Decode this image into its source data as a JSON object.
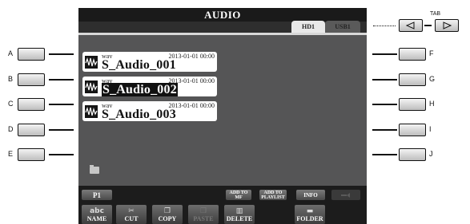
{
  "screen": {
    "title": "AUDIO",
    "tabs": [
      {
        "label": "HD1",
        "active": true
      },
      {
        "label": "USB1",
        "active": false
      }
    ],
    "files": [
      {
        "type": "wav",
        "date": "2013-01-01 00:00",
        "name": "S_Audio_001",
        "selected": false
      },
      {
        "type": "wav",
        "date": "2013-01-01 00:00",
        "name": "S_Audio_002",
        "selected": true
      },
      {
        "type": "wav",
        "date": "2013-01-01 00:00",
        "name": "S_Audio_003",
        "selected": false
      }
    ],
    "page_label": "P1",
    "side_buttons": {
      "add_to_mf": [
        "ADD TO",
        "MF"
      ],
      "add_to_playlist": [
        "ADD TO",
        "PLAYLIST"
      ],
      "info": "INFO"
    },
    "name_button": {
      "icon_text": "abc",
      "label": "NAME"
    },
    "function_buttons": [
      {
        "label": "CUT",
        "enabled": true
      },
      {
        "label": "COPY",
        "enabled": true
      },
      {
        "label": "PASTE",
        "enabled": false
      },
      {
        "label": "DELETE",
        "enabled": true
      },
      {
        "label": "FOLDER",
        "enabled": true
      }
    ]
  },
  "hardware": {
    "left_labels": [
      "A",
      "B",
      "C",
      "D",
      "E"
    ],
    "right_labels": [
      "F",
      "G",
      "H",
      "I",
      "J"
    ],
    "tab_label": "TAB"
  }
}
